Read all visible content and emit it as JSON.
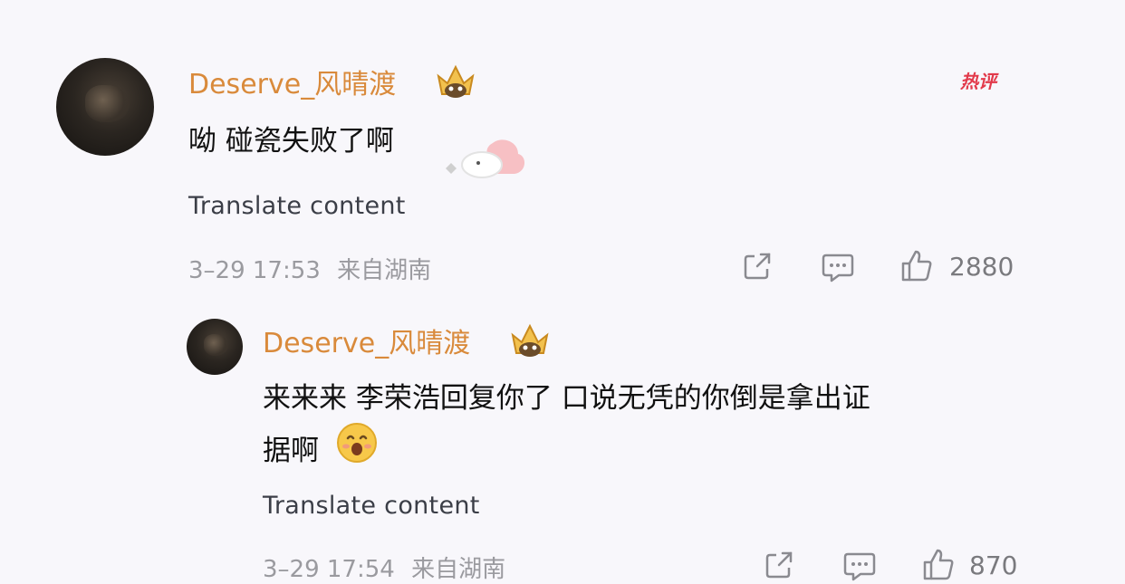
{
  "comment": {
    "username": "Deserve_风晴渡",
    "text": "呦 碰瓷失败了啊",
    "translate_label": "Translate content",
    "time": "3–29 17:53",
    "location": "来自湖南",
    "like_count": "2880",
    "hot_tag": "热评",
    "icons": [
      "crown-badge-icon",
      "share-icon",
      "comment-icon",
      "like-icon",
      "cloud-bird-sticker-icon"
    ]
  },
  "reply": {
    "username": "Deserve_风晴渡",
    "text_line1": "来来来 李荣浩回复你了 口说无凭的你倒是拿出证",
    "text_line2": "据啊",
    "translate_label": "Translate content",
    "time": "3–29 17:54",
    "location": "来自湖南",
    "like_count": "870",
    "icons": [
      "crown-badge-icon",
      "smile-emoji-icon",
      "share-icon",
      "comment-icon",
      "like-icon"
    ]
  },
  "colors": {
    "username": "#d98a3b",
    "meta": "#9a9a9f",
    "hot_tag": "#e23a4b",
    "background": "#f8f7fb"
  }
}
